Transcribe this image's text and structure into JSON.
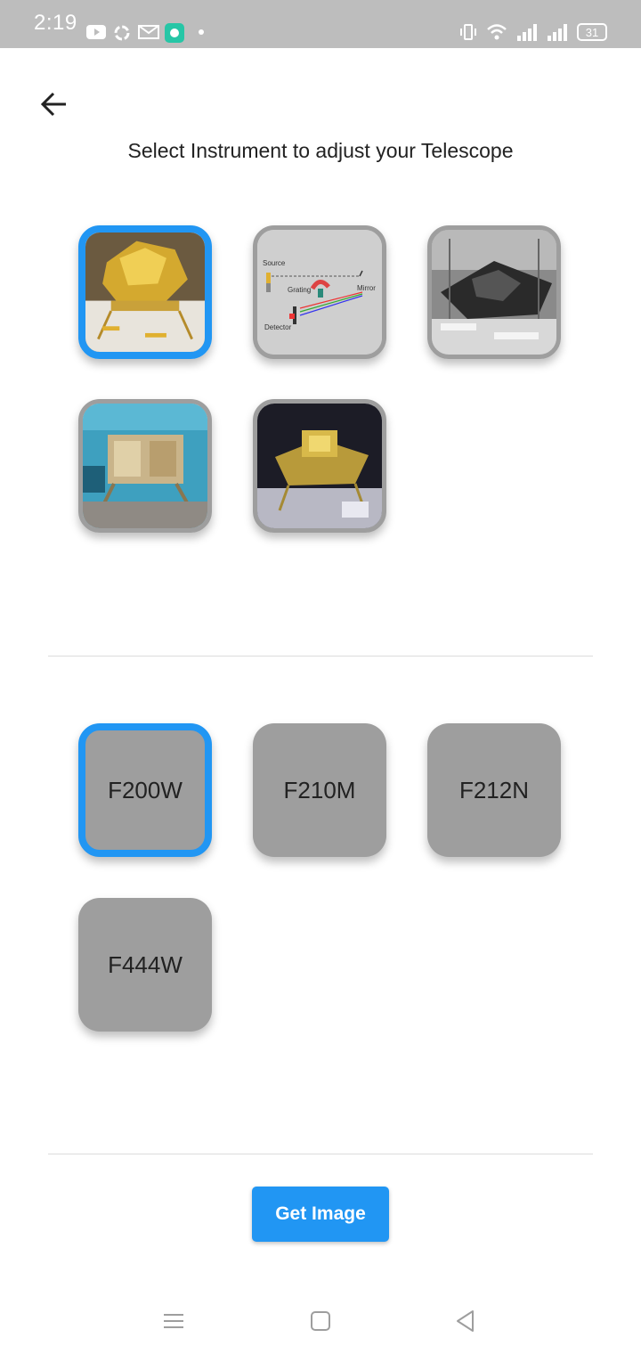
{
  "status_bar": {
    "time": "2:19",
    "battery": "31",
    "left_icons": [
      "youtube-icon",
      "sync-icon",
      "mail-icon",
      "chat-app-icon",
      "dot-icon"
    ],
    "right_icons": [
      "vibrate-icon",
      "wifi-icon",
      "signal-icon",
      "signal-icon"
    ]
  },
  "header": {
    "title": "Select Instrument to adjust your Telescope"
  },
  "instruments": [
    {
      "id": "instrument-1",
      "selected": true
    },
    {
      "id": "instrument-2",
      "selected": false,
      "diagram_labels": {
        "source": "Source",
        "grating": "Grating",
        "mirror": "Mirror",
        "detector": "Detector"
      }
    },
    {
      "id": "instrument-3",
      "selected": false
    },
    {
      "id": "instrument-4",
      "selected": false
    },
    {
      "id": "instrument-5",
      "selected": false
    }
  ],
  "filters": [
    {
      "label": "F200W",
      "selected": true
    },
    {
      "label": "F210M",
      "selected": false
    },
    {
      "label": "F212N",
      "selected": false
    },
    {
      "label": "F444W",
      "selected": false
    }
  ],
  "actions": {
    "get_image_label": "Get Image"
  },
  "colors": {
    "accent": "#2196f3",
    "tile_gray": "#9e9e9e",
    "status_bar": "#bdbdbd"
  }
}
